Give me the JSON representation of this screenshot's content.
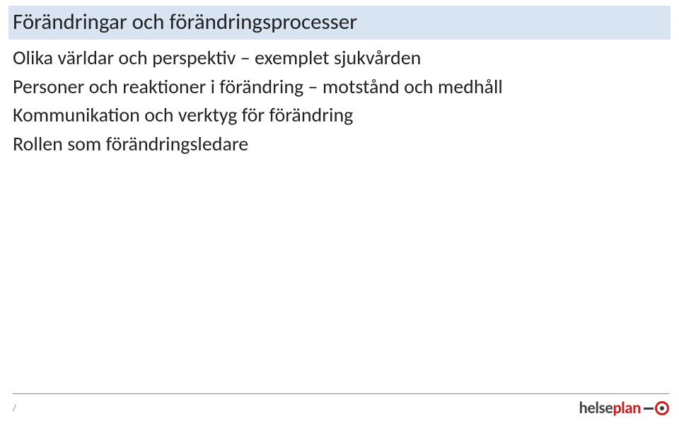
{
  "title": "Förändringar och förändringsprocesser",
  "body": {
    "items": [
      "Olika världar och perspektiv – exemplet sjukvården",
      "Personer och reaktioner i förändring – motstånd och medhåll",
      "Kommunikation och verktyg för förändring",
      "Rollen som förändringsledare"
    ]
  },
  "footer": {
    "left": "/"
  },
  "logo": {
    "part1": "helse",
    "part2": "plan"
  }
}
